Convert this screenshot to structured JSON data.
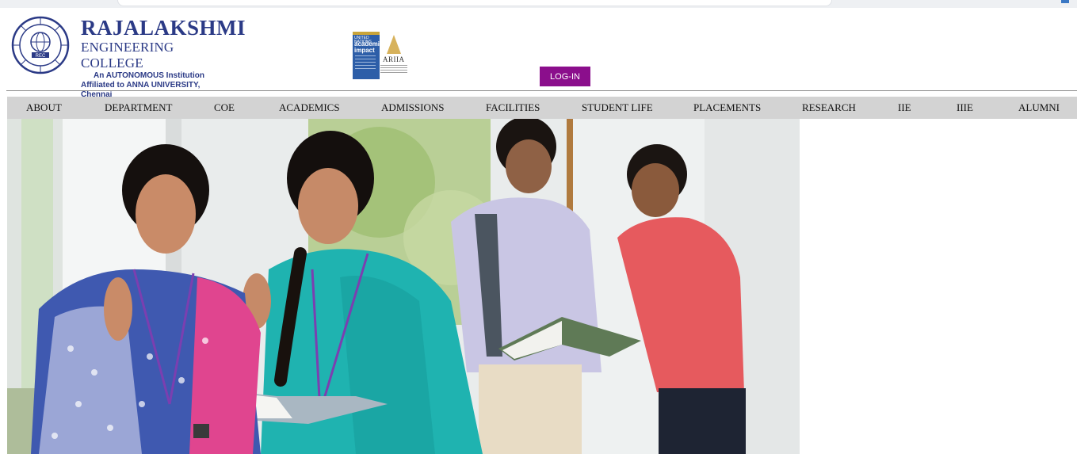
{
  "header": {
    "brand_line1": "RAJALAKSHMI",
    "brand_line2": "ENGINEERING COLLEGE",
    "brand_line3": "An AUTONOMOUS Institution",
    "brand_line4": "Affiliated to ANNA UNIVERSITY, Chennai",
    "seal_text": "REC",
    "impact_badge_line1": "UNITED NATIONS",
    "impact_badge_line2": "academic impact",
    "ariia_badge": "ARIIA",
    "login_label": "LOG-IN",
    "login_color": "#8b0e8c",
    "brand_color": "#2b3a86"
  },
  "nav": {
    "items": [
      {
        "label": "ABOUT"
      },
      {
        "label": "DEPARTMENT"
      },
      {
        "label": "COE"
      },
      {
        "label": "ACADEMICS"
      },
      {
        "label": "ADMISSIONS"
      },
      {
        "label": "FACILITIES"
      },
      {
        "label": "STUDENT LIFE"
      },
      {
        "label": "PLACEMENTS"
      },
      {
        "label": "RESEARCH"
      },
      {
        "label": "IIE"
      },
      {
        "label": "IIIE"
      },
      {
        "label": "ALUMNI"
      }
    ],
    "background": "#d3d3d3"
  },
  "hero": {
    "image_name": "students-photo"
  }
}
